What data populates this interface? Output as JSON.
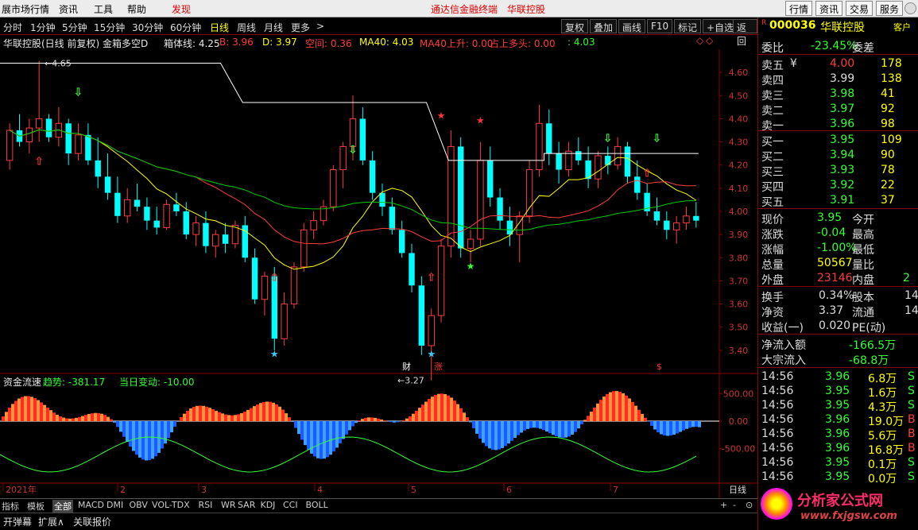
{
  "menu": {
    "items": [
      "展市场行情",
      "资讯",
      "工具",
      "帮助",
      "发现"
    ],
    "center": [
      "通达信金融终端",
      "华联控股"
    ],
    "right_buttons": [
      "行情",
      "资讯",
      "交易",
      "服务"
    ]
  },
  "period": {
    "tabs": [
      "分时",
      "1分钟",
      "5分钟",
      "15分钟",
      "30分钟",
      "60分钟",
      "日线",
      "周线",
      "月线",
      "更多",
      ">"
    ],
    "active": "日线",
    "tools": [
      "复权",
      "叠加",
      "画线",
      "F10",
      "标记",
      "+自选",
      "返回"
    ]
  },
  "infobar": {
    "title": "华联控股(日线 前复权) 金箱多空D",
    "box_label": "箱体线: 4.25",
    "b_label": "B: 3.96",
    "d_label": "D: 3.97",
    "kong_label": "空间: 0.36",
    "ma40_label": "MA40: 4.03",
    "ma40up_label": "MA40上升: 0.00",
    "zhan_label": "占上多头: 0.00",
    "last_label": ": 4.03"
  },
  "subpanel": {
    "title": "资金流速",
    "trend": "趋势: -381.17",
    "change": "当日变动: -10.00"
  },
  "chart_labels": {
    "high": "4.65",
    "low": "3.27",
    "cai": "财",
    "zhang": "涨",
    "s": "$"
  },
  "price_axis": [
    "4.60",
    "4.50",
    "4.40",
    "4.30",
    "4.20",
    "4.10",
    "4.00",
    "3.90",
    "3.80",
    "3.70",
    "3.60",
    "3.50",
    "3.40"
  ],
  "sub_axis": [
    "500.00",
    "0.00",
    "-500.00"
  ],
  "x_axis": [
    "2021年",
    "2",
    "3",
    "4",
    "5",
    "6",
    "7"
  ],
  "x_axis_right": "日线",
  "bottom_indicators": [
    "指标",
    "模板",
    "全部",
    "MACD",
    "DMI",
    "OBV",
    "VOL-TDX",
    "RSI",
    "WR",
    "SAR",
    "KDJ",
    "CCI",
    "BOLL"
  ],
  "bottom_right": [
    "+",
    "-",
    "⊙"
  ],
  "statusbar": [
    "开弹幕",
    "扩展∧",
    "关联报价"
  ],
  "watermark": {
    "name": "分析家公式网",
    "url": "www.fxjgsw.com"
  },
  "sidebar": {
    "code": "000036",
    "name": "华联控股",
    "tag": "客户",
    "weibi_label": "委比",
    "weibi_value": "-23.45%",
    "weicha_label": "委差",
    "asks": [
      {
        "label": "卖五",
        "price": "4.00",
        "vol": "178",
        "mark": "¥"
      },
      {
        "label": "卖四",
        "price": "3.99",
        "vol": "138"
      },
      {
        "label": "卖三",
        "price": "3.98",
        "vol": "41"
      },
      {
        "label": "卖二",
        "price": "3.97",
        "vol": "92"
      },
      {
        "label": "卖一",
        "price": "3.96",
        "vol": "98"
      }
    ],
    "bids": [
      {
        "label": "买一",
        "price": "3.95",
        "vol": "109"
      },
      {
        "label": "买二",
        "price": "3.94",
        "vol": "90"
      },
      {
        "label": "买三",
        "price": "3.93",
        "vol": "78"
      },
      {
        "label": "买四",
        "price": "3.92",
        "vol": "22"
      },
      {
        "label": "买五",
        "price": "3.91",
        "vol": "37"
      }
    ],
    "stats": [
      {
        "l1": "现价",
        "v1": "3.95",
        "l2": "今开",
        "v2": ""
      },
      {
        "l1": "涨跌",
        "v1": "-0.04",
        "l2": "最高",
        "v2": ""
      },
      {
        "l1": "涨幅",
        "v1": "-1.00%",
        "l2": "最低",
        "v2": ""
      },
      {
        "l1": "总量",
        "v1": "50567",
        "l2": "量比",
        "v2": ""
      },
      {
        "l1": "外盘",
        "v1": "23146",
        "l2": "内盘",
        "v2": "2"
      }
    ],
    "stats2": [
      {
        "l1": "换手",
        "v1": "0.34%",
        "l2": "股本",
        "v2": "14"
      },
      {
        "l1": "净资",
        "v1": "3.37",
        "l2": "流通",
        "v2": "14"
      },
      {
        "l1": "收益(一)",
        "v1": "0.020",
        "l2": "PE(动)",
        "v2": ""
      }
    ],
    "flow": [
      {
        "label": "净流入额",
        "value": "-166.5万"
      },
      {
        "label": "大宗流入",
        "value": "-68.8万"
      }
    ],
    "trades": [
      {
        "time": "14:56",
        "price": "3.96",
        "vol": "6.8万",
        "side": "S"
      },
      {
        "time": "14:56",
        "price": "3.95",
        "vol": "1.6万",
        "side": "S"
      },
      {
        "time": "14:56",
        "price": "3.95",
        "vol": "4.3万",
        "side": "S"
      },
      {
        "time": "14:56",
        "price": "3.96",
        "vol": "19.0万",
        "side": "B"
      },
      {
        "time": "14:56",
        "price": "3.96",
        "vol": "5.6万",
        "side": "B"
      },
      {
        "time": "14:56",
        "price": "3.96",
        "vol": "16.8万",
        "side": "B"
      },
      {
        "time": "14:56",
        "price": "3.95",
        "vol": "0.1万",
        "side": "S"
      },
      {
        "time": "14:56",
        "price": "3.95",
        "vol": "0.0万",
        "side": "S"
      }
    ]
  },
  "chart_data": {
    "type": "candlestick",
    "title": "华联控股(日线 前复权) 金箱多空D",
    "ylim": [
      3.3,
      4.7
    ],
    "x_ticks": [
      "2021年",
      "2",
      "3",
      "4",
      "5",
      "6",
      "7"
    ],
    "ohlc": [
      [
        4.22,
        4.38,
        4.18,
        4.35
      ],
      [
        4.35,
        4.42,
        4.28,
        4.3
      ],
      [
        4.3,
        4.4,
        4.25,
        4.36
      ],
      [
        4.36,
        4.65,
        4.3,
        4.4
      ],
      [
        4.4,
        4.42,
        4.3,
        4.32
      ],
      [
        4.32,
        4.45,
        4.28,
        4.38
      ],
      [
        4.38,
        4.4,
        4.2,
        4.25
      ],
      [
        4.25,
        4.38,
        4.22,
        4.33
      ],
      [
        4.33,
        4.38,
        4.2,
        4.22
      ],
      [
        4.22,
        4.32,
        4.1,
        4.15
      ],
      [
        4.15,
        4.25,
        4.05,
        4.08
      ],
      [
        4.08,
        4.15,
        3.95,
        3.98
      ],
      [
        3.98,
        4.1,
        3.95,
        4.05
      ],
      [
        4.05,
        4.12,
        4.0,
        4.02
      ],
      [
        4.02,
        4.06,
        3.92,
        3.96
      ],
      [
        3.96,
        4.02,
        3.9,
        3.93
      ],
      [
        3.93,
        4.05,
        3.92,
        4.03
      ],
      [
        4.03,
        4.08,
        3.98,
        4.0
      ],
      [
        4.0,
        4.04,
        3.88,
        3.9
      ],
      [
        3.9,
        3.98,
        3.85,
        3.95
      ],
      [
        3.95,
        4.0,
        3.82,
        3.85
      ],
      [
        3.85,
        3.92,
        3.8,
        3.9
      ],
      [
        3.9,
        3.95,
        3.82,
        3.86
      ],
      [
        3.86,
        3.96,
        3.84,
        3.94
      ],
      [
        3.94,
        3.98,
        3.78,
        3.8
      ],
      [
        3.8,
        3.84,
        3.6,
        3.62
      ],
      [
        3.62,
        3.74,
        3.55,
        3.72
      ],
      [
        3.72,
        3.76,
        3.4,
        3.45
      ],
      [
        3.45,
        3.65,
        3.42,
        3.6
      ],
      [
        3.6,
        3.78,
        3.58,
        3.76
      ],
      [
        3.76,
        3.95,
        3.74,
        3.92
      ],
      [
        3.92,
        4.0,
        3.88,
        3.96
      ],
      [
        3.96,
        4.05,
        3.94,
        4.02
      ],
      [
        4.02,
        4.2,
        4.0,
        4.18
      ],
      [
        4.18,
        4.3,
        4.1,
        4.28
      ],
      [
        4.28,
        4.5,
        4.22,
        4.4
      ],
      [
        4.4,
        4.45,
        4.2,
        4.22
      ],
      [
        4.22,
        4.26,
        4.05,
        4.08
      ],
      [
        4.08,
        4.12,
        3.98,
        4.02
      ],
      [
        4.02,
        4.06,
        3.9,
        3.92
      ],
      [
        3.92,
        3.96,
        3.8,
        3.82
      ],
      [
        3.82,
        3.86,
        3.65,
        3.68
      ],
      [
        3.68,
        3.72,
        3.38,
        3.42
      ],
      [
        3.42,
        3.58,
        3.27,
        3.55
      ],
      [
        3.55,
        3.88,
        3.52,
        3.85
      ],
      [
        3.85,
        4.35,
        3.8,
        4.28
      ],
      [
        4.28,
        4.32,
        3.8,
        3.84
      ],
      [
        3.84,
        3.92,
        3.78,
        3.88
      ],
      [
        3.88,
        4.3,
        3.85,
        4.22
      ],
      [
        4.22,
        4.28,
        4.02,
        4.06
      ],
      [
        4.06,
        4.1,
        3.92,
        3.96
      ],
      [
        3.96,
        4.02,
        3.85,
        3.9
      ],
      [
        3.9,
        4.0,
        3.78,
        3.98
      ],
      [
        3.98,
        4.22,
        3.95,
        4.18
      ],
      [
        4.18,
        4.46,
        4.15,
        4.38
      ],
      [
        4.38,
        4.44,
        4.2,
        4.25
      ],
      [
        4.25,
        4.3,
        4.12,
        4.18
      ],
      [
        4.18,
        4.3,
        4.15,
        4.26
      ],
      [
        4.26,
        4.32,
        4.2,
        4.22
      ],
      [
        4.22,
        4.28,
        4.1,
        4.14
      ],
      [
        4.14,
        4.26,
        4.1,
        4.24
      ],
      [
        4.24,
        4.28,
        4.16,
        4.2
      ],
      [
        4.2,
        4.32,
        4.18,
        4.28
      ],
      [
        4.28,
        4.3,
        4.12,
        4.15
      ],
      [
        4.15,
        4.22,
        4.05,
        4.08
      ],
      [
        4.08,
        4.12,
        3.98,
        4.0
      ],
      [
        4.0,
        4.06,
        3.94,
        3.96
      ],
      [
        3.96,
        4.0,
        3.88,
        3.92
      ],
      [
        3.92,
        3.98,
        3.86,
        3.95
      ],
      [
        3.95,
        4.02,
        3.92,
        3.98
      ],
      [
        3.98,
        4.04,
        3.93,
        3.96
      ]
    ],
    "series": [
      {
        "name": "MA40",
        "values": []
      }
    ]
  }
}
